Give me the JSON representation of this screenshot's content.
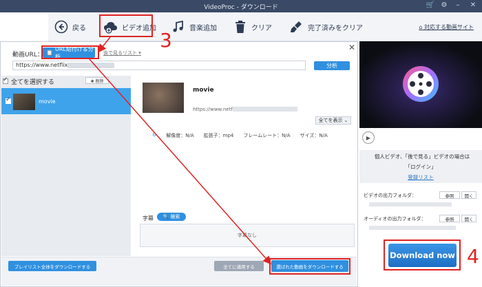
{
  "window": {
    "title": "VideoProc - ダウンロード"
  },
  "toolbar": {
    "back": "戻る",
    "add_video": "ビデオ追加",
    "add_music": "音楽追加",
    "clear": "クリア",
    "clear_done": "完了済みをクリア",
    "supported_sites": "対応する動画サイト"
  },
  "dialog": {
    "url_label": "動画URL：",
    "paste_analyze": "URL貼付け＆分析",
    "watch_later": "後で見るリスト",
    "url_value": "https://www.netflix.com/",
    "analyze": "分析",
    "select_all": "全てを選択する",
    "delete": "✚ 削除",
    "items": [
      {
        "label": "movie"
      }
    ],
    "detail": {
      "title": "movie",
      "url": "https://www.netflix.com/",
      "show_all": "全てを表示",
      "resolution": "解像度：N/A",
      "extension": "拡張子：mp4",
      "framerate": "フレームレート：N/A",
      "size": "サイズ：N/A",
      "subtitle_label": "字幕",
      "subtitle_search": "検索",
      "no_subtitle": "字幕なし"
    },
    "playlist_download": "プレイリスト全体をダウンロードする",
    "apply_all": "全てに適用する",
    "download_selected": "選ばれた動画をダウンロードする"
  },
  "right": {
    "info_line1": "個人ビデオ、「後で見る」ビデオの場合は",
    "info_line2": "「ログイン」",
    "register_list": "登録リスト",
    "video_folder": "ビデオの出力フォルダ：",
    "audio_folder": "オーディオの出力フォルダ：",
    "browse": "参照",
    "open": "開く",
    "download_now": "Download now"
  },
  "annotations": {
    "step3": "3",
    "step4": "4"
  },
  "colors": {
    "accent": "#2f90e0",
    "annotation": "#e02222",
    "titlebar": "#3a4a66"
  }
}
